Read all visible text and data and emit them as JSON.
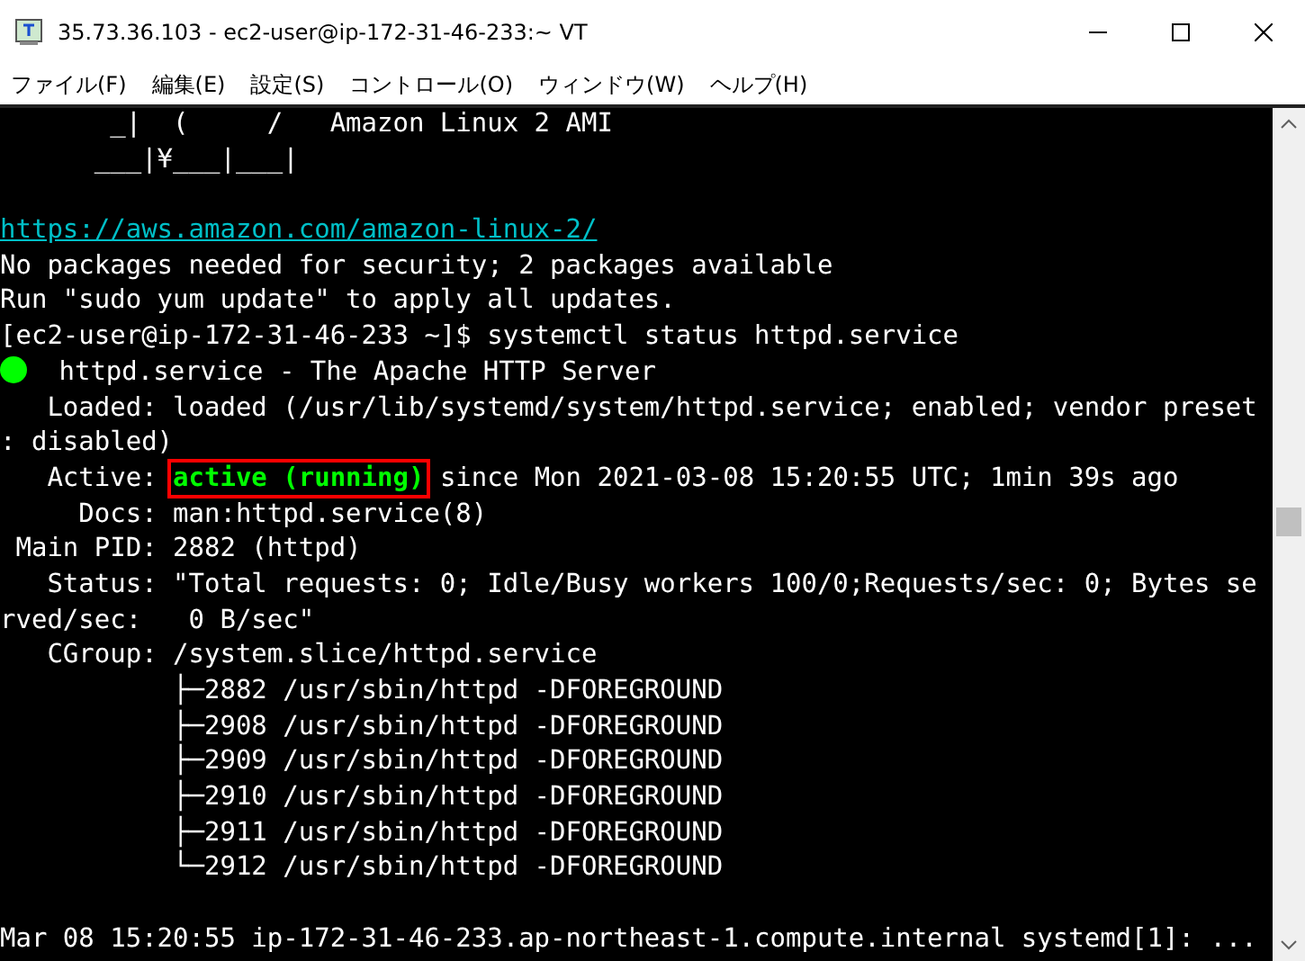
{
  "window": {
    "title": "35.73.36.103 - ec2-user@ip-172-31-46-233:~ VT"
  },
  "menu": [
    "ファイル(F)",
    "編集(E)",
    "設定(S)",
    "コントロール(O)",
    "ウィンドウ(W)",
    "ヘルプ(H)"
  ],
  "terminal": {
    "lines": [
      {
        "kind": "text",
        "text": "       _|  (     /   Amazon Linux 2 AMI"
      },
      {
        "kind": "text",
        "text": "      ___|¥___|___|"
      },
      {
        "kind": "blank"
      },
      {
        "kind": "link",
        "text": "https://aws.amazon.com/amazon-linux-2/"
      },
      {
        "kind": "text",
        "text": "No packages needed for security; 2 packages available"
      },
      {
        "kind": "text",
        "text": "Run \"sudo yum update\" to apply all updates."
      },
      {
        "kind": "text",
        "text": "[ec2-user@ip-172-31-46-233 ~]$ systemctl status httpd.service"
      },
      {
        "kind": "service",
        "color": "#00ff00",
        "text": " httpd.service - The Apache HTTP Server"
      },
      {
        "kind": "text",
        "text": "   Loaded: loaded (/usr/lib/systemd/system/httpd.service; enabled; vendor preset"
      },
      {
        "kind": "text",
        "text": ": disabled)"
      },
      {
        "kind": "active",
        "label": "   Active: ",
        "state": "active (running)",
        "highlighted": true,
        "rest": " since Mon 2021-03-08 15:20:55 UTC; 1min 39s ago"
      },
      {
        "kind": "text",
        "text": "     Docs: man:httpd.service(8)"
      },
      {
        "kind": "text",
        "text": " Main PID: 2882 (httpd)"
      },
      {
        "kind": "text",
        "text": "   Status: \"Total requests: 0; Idle/Busy workers 100/0;Requests/sec: 0; Bytes se"
      },
      {
        "kind": "text",
        "text": "rved/sec:   0 B/sec\""
      },
      {
        "kind": "text",
        "text": "   CGroup: /system.slice/httpd.service"
      },
      {
        "kind": "text",
        "text": "           ├─2882 /usr/sbin/httpd -DFOREGROUND"
      },
      {
        "kind": "text",
        "text": "           ├─2908 /usr/sbin/httpd -DFOREGROUND"
      },
      {
        "kind": "text",
        "text": "           ├─2909 /usr/sbin/httpd -DFOREGROUND"
      },
      {
        "kind": "text",
        "text": "           ├─2910 /usr/sbin/httpd -DFOREGROUND"
      },
      {
        "kind": "text",
        "text": "           ├─2911 /usr/sbin/httpd -DFOREGROUND"
      },
      {
        "kind": "text",
        "text": "           └─2912 /usr/sbin/httpd -DFOREGROUND"
      },
      {
        "kind": "blank"
      },
      {
        "kind": "text",
        "text": "Mar 08 15:20:55 ip-172-31-46-233.ap-northeast-1.compute.internal systemd[1]: ..."
      }
    ]
  }
}
